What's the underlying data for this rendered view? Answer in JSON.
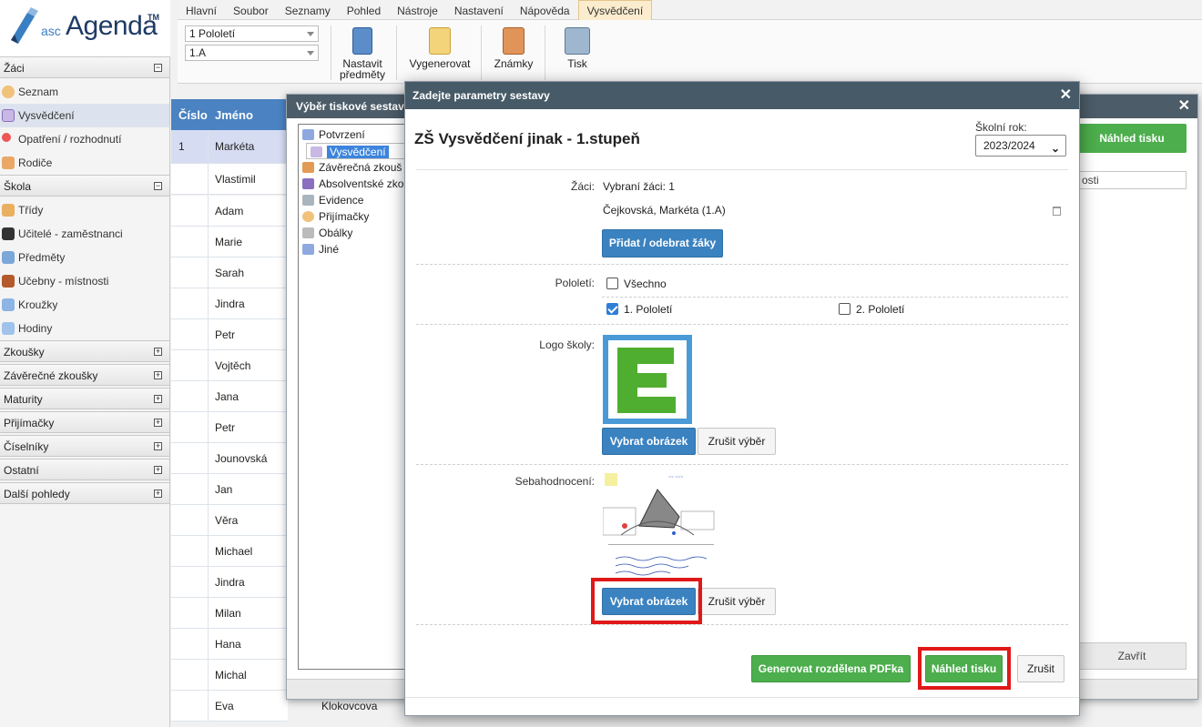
{
  "app": {
    "logo_asc": "asc",
    "logo_agenda": "Agenda",
    "logo_tm": "TM"
  },
  "menu": [
    "Hlavní",
    "Soubor",
    "Seznamy",
    "Pohled",
    "Nástroje",
    "Nastavení",
    "Nápověda",
    "Vysvědčení"
  ],
  "menu_active": "Vysvědčení",
  "toolbar": {
    "period_select": "1 Pololetí",
    "class_select": "1.A",
    "btn_subjects": "Nastavit předměty",
    "btn_subjects_l1": "Nastavit",
    "btn_subjects_l2": "předměty",
    "btn_generate": "Vygenerovat",
    "btn_grades": "Známky",
    "btn_print": "Tisk"
  },
  "sidebar": {
    "sections": [
      {
        "label": "Žáci",
        "expanded": true,
        "toggle": "−",
        "items": [
          "Seznam",
          "Vysvědčení",
          "Opatření / rozhodnutí",
          "Rodiče"
        ]
      },
      {
        "label": "Škola",
        "expanded": true,
        "toggle": "−",
        "items": [
          "Třídy",
          "Učitelé - zaměstnanci",
          "Předměty",
          "Učebny - místnosti",
          "Kroužky",
          "Hodiny"
        ]
      },
      {
        "label": "Zkoušky",
        "toggle": "+"
      },
      {
        "label": "Závěrečné zkoušky",
        "toggle": "+"
      },
      {
        "label": "Maturity",
        "toggle": "+"
      },
      {
        "label": "Přijímačky",
        "toggle": "+"
      },
      {
        "label": "Číselníky",
        "toggle": "+"
      },
      {
        "label": "Ostatní",
        "toggle": "+"
      },
      {
        "label": "Další pohledy",
        "toggle": "+"
      }
    ],
    "active_item": "Vysvědčení"
  },
  "table": {
    "headers": [
      "Číslo",
      "Jméno"
    ],
    "rows": [
      {
        "num": "1",
        "name": "Markéta"
      },
      {
        "num": "",
        "name": "Vlastimil"
      },
      {
        "num": "",
        "name": "Adam"
      },
      {
        "num": "",
        "name": "Marie"
      },
      {
        "num": "",
        "name": "Sarah"
      },
      {
        "num": "",
        "name": "Jindra"
      },
      {
        "num": "",
        "name": "Petr"
      },
      {
        "num": "",
        "name": "Vojtěch"
      },
      {
        "num": "",
        "name": "Jana"
      },
      {
        "num": "",
        "name": "Petr"
      },
      {
        "num": "",
        "name": "Jounovská"
      },
      {
        "num": "",
        "name": "Jan"
      },
      {
        "num": "",
        "name": "Věra"
      },
      {
        "num": "",
        "name": "Michael"
      },
      {
        "num": "",
        "name": "Jindra"
      },
      {
        "num": "",
        "name": "Milan"
      },
      {
        "num": "",
        "name": "Hana"
      },
      {
        "num": "",
        "name": "Michal"
      },
      {
        "num": "",
        "name": "Eva"
      }
    ],
    "extra_surname": "Klokovcova"
  },
  "report_dialog": {
    "title": "Výběr tiskové sestav",
    "items": [
      "Potvrzení",
      "Vysvědčení",
      "Závěrečná zkouš",
      "Absolventské zko",
      "Evidence",
      "Přijímačky",
      "Obálky",
      "Jiné"
    ],
    "selected": "Vysvědčení",
    "preview_btn": "Náhled tisku",
    "dropdown_partial": "osti",
    "close_btn": "Zavřít"
  },
  "params_dialog": {
    "header": "Zadejte parametry sestavy",
    "report_title": "ZŠ Vysvědčení jinak - 1.stupeň",
    "school_year_label": "Školní rok:",
    "school_year_value": "2023/2024",
    "students_label": "Žáci:",
    "students_selected": "Vybraní žáci: 1",
    "student_name": "Čejkovská, Markéta (1.A)",
    "add_remove_btn": "Přidat / odebrat žáky",
    "period_label": "Pololetí:",
    "all_label": "Všechno",
    "all_checked": false,
    "period1_label": "1. Pololetí",
    "period1_checked": true,
    "period2_label": "2. Pololetí",
    "period2_checked": false,
    "logo_label": "Logo školy:",
    "select_image_btn": "Vybrat obrázek",
    "cancel_selection_btn": "Zrušit výběr",
    "self_eval_label": "Sebahodnocení:",
    "select_image_btn2": "Vybrat obrázek",
    "cancel_selection_btn2": "Zrušit výběr",
    "generate_btn": "Generovat rozdělena PDFka",
    "preview_btn": "Náhled tisku",
    "cancel_btn": "Zrušit"
  },
  "colors": {
    "accent_blue": "#3b82c0",
    "accent_green": "#4cae4c",
    "highlight_red": "#e01818",
    "header_dark": "#475a67"
  }
}
